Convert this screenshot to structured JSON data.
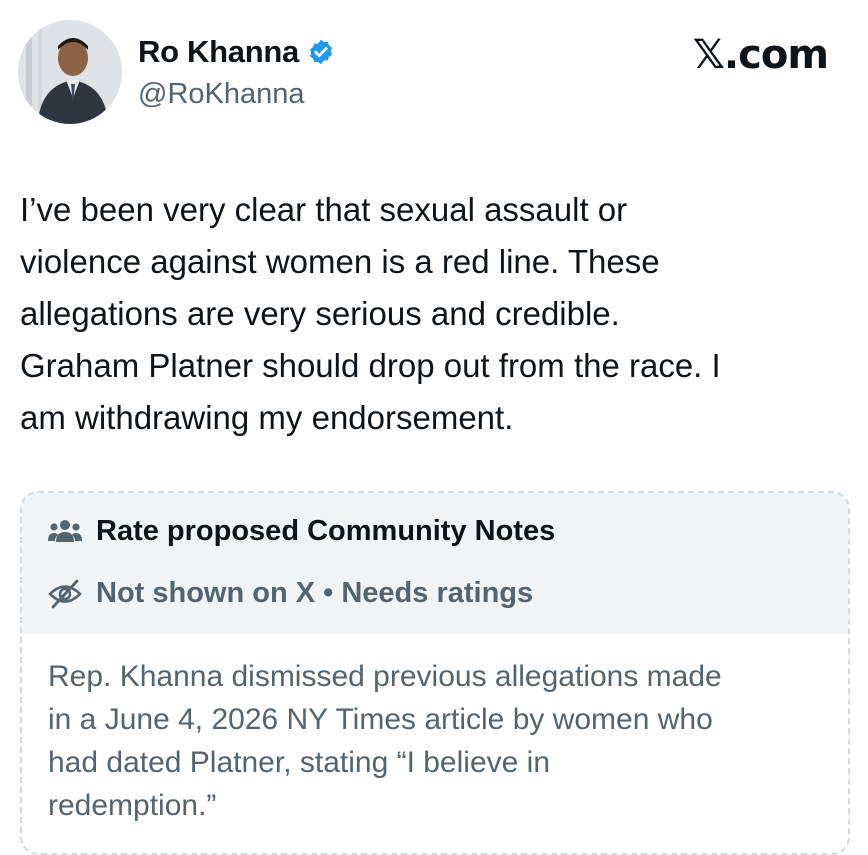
{
  "author": {
    "display_name": "Ro Khanna",
    "handle": "@RoKhanna",
    "verified": true,
    "avatar_icon": "profile-photo"
  },
  "brand": {
    "label": "𝕏.com"
  },
  "tweet": {
    "text": "I’ve been very clear that sexual assault or\nviolence against women is a red line. These\nallegations are very serious and credible.\nGraham Platner should drop out from the race. I\nam withdrawing my endorsement."
  },
  "community_note": {
    "title": "Rate proposed Community Notes",
    "title_icon": "people-icon",
    "status": "Not shown on X • Needs ratings",
    "status_icon": "eye-off-icon",
    "body": "Rep. Khanna dismissed previous allegations made\nin a June 4, 2026 NY Times article by women who\nhad dated Platner, stating “I believe in\nredemption.”"
  },
  "colors": {
    "verified_badge": "#1d9bf0",
    "primary_text": "#0f1419",
    "secondary_text": "#536471",
    "note_header_bg": "#f1f4f6",
    "note_border": "#cfd9de"
  }
}
